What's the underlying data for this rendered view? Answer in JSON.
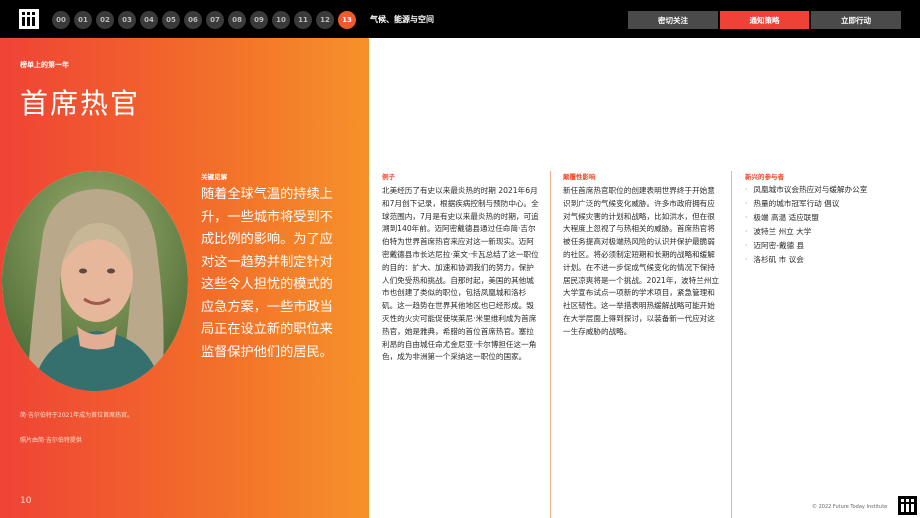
{
  "nav": {
    "numbers": [
      "00",
      "01",
      "02",
      "03",
      "04",
      "05",
      "06",
      "07",
      "08",
      "09",
      "10",
      "11",
      "12",
      "13"
    ],
    "active": "13",
    "section": "气候、能源与空间",
    "buttons": [
      "密切关注",
      "通知策略",
      "立即行动"
    ]
  },
  "hero": {
    "kicker": "榜单上的第一年",
    "title": "首席热官",
    "caption_1": "简·吉尔伯特于2021年成为首位首席热官。",
    "caption_2": "照片由简·吉尔伯特提供",
    "insight_label": "关键见解",
    "insight": "随着全球气温的持续上升，一些城市将受到不成比例的影响。为了应对这一趋势并制定针对这些令人担忧的模式的应急方案，一些市政当局正在设立新的职位来监督保护他们的居民。",
    "page": "10"
  },
  "columns": {
    "examples_label": "例子",
    "examples_text": "北美经历了有史以来最炎热的时期 2021年6月和7月创下记录，根据疾病控制与预防中心。全球范围内，7月是有史以来最炎热的时期，可追溯到140年前。迈阿密戴德县通过任命简·吉尔伯特为世界首席热官来应对这一新现实。迈阿密戴德县市长达尼拉·莱文·卡瓦总结了这一职位的目的：扩大、加速和协调我们的努力，保护人们免受热和挑战。自那时起，美国的其他城市也创建了类似的职位，包括凤凰城和洛杉矶。这一趋势在世界其他地区也已经形成。毁灭性的火灾可能促使埃莱尼·米里维利成为首席热官，她是雅典，希腊的首位首席热官。塞拉利昂的自由城任命尤金尼亚·卡尔博担任这一角色，成为非洲第一个采纳这一职位的国家。",
    "impact_label": "颠覆性影响",
    "impact_text": "新任首席热官职位的创建表明世界终于开始意识到广泛的气候变化威胁。许多市政府拥有应对气候灾害的计划和战略，比如洪水，但在很大程度上忽视了与热相关的威胁。首席热官将被任务提高对极端热风险的认识并保护最脆弱的社区。将必须制定短期和长期的战略和缓解计划。在不进一步促成气候变化的情况下保持居民凉爽将是一个挑战。2021年，波特兰州立大学宣布试点一项新的学术项目，紧急管理和社区韧性。这一举措表明热缓解战略可能开始在大学层面上得到探讨，以装备新一代应对这一生存威胁的战略。",
    "players_label": "新兴的参与者",
    "players": [
      "凤凰城市议会热应对与缓解办公室",
      "热量的城市冠军行动 倡议",
      "极端 高温 适应联盟",
      "波特兰 州立 大学",
      "迈阿密-戴德 县",
      "洛杉矶 市 议会"
    ]
  },
  "footer": {
    "copyright": "© 2022 Future Today Institute"
  },
  "colors": {
    "accent": "#ef4b2d",
    "gradient_start": "#ef4336",
    "gradient_end": "#f6922a"
  }
}
